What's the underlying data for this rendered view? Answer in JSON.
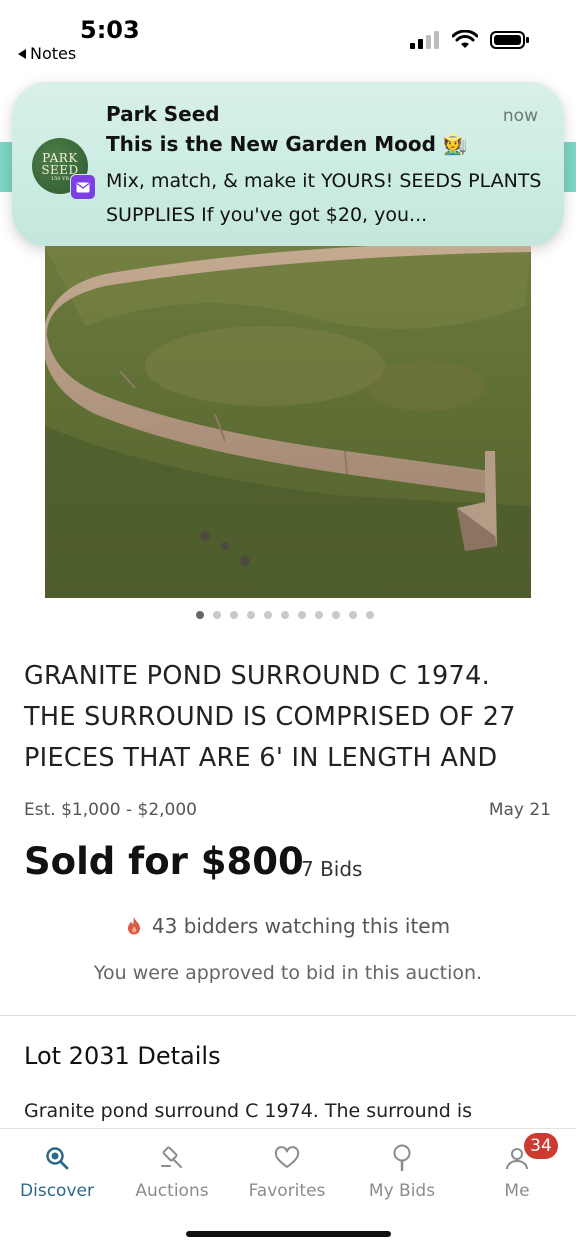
{
  "status_bar": {
    "time": "5:03",
    "back_label": "Notes"
  },
  "notification": {
    "app": "Park Seed",
    "time": "now",
    "title": "This is the New Garden Mood 🧑‍🌾",
    "body": "Mix, match, & make it YOURS! SEEDS PLANTS SUPPLIES If you've got $20, you...",
    "logo": {
      "line1": "PARK",
      "line2": "SEED",
      "line3": "150 YR"
    },
    "badge_icon": "yahoo-mail-icon"
  },
  "carousel": {
    "total": 11,
    "active_index": 0
  },
  "lot": {
    "title": "GRANITE POND SURROUND C 1974.\nTHE SURROUND IS COMPRISED OF 27\nPIECES THAT ARE 6' IN LENGTH AND",
    "estimate": "Est. $1,000 - $2,000",
    "date": "May 21",
    "sold": "Sold for $800",
    "bids": "7 Bids",
    "watching": "43 bidders watching this item",
    "approved": "You were approved to bid in this auction.",
    "details_heading": "Lot 2031 Details",
    "details_text": "Granite pond surround C 1974. The surround is"
  },
  "tabs": [
    {
      "label": "Discover",
      "icon": "search-icon",
      "active": true
    },
    {
      "label": "Auctions",
      "icon": "gavel-icon",
      "active": false
    },
    {
      "label": "Favorites",
      "icon": "heart-icon",
      "active": false
    },
    {
      "label": "My Bids",
      "icon": "bid-paddle-icon",
      "active": false
    },
    {
      "label": "Me",
      "icon": "person-icon",
      "active": false,
      "badge": "34"
    }
  ],
  "colors": {
    "accent": "#2a6a8a",
    "badge": "#cc3a30",
    "notification_bg": "#cbece2"
  }
}
